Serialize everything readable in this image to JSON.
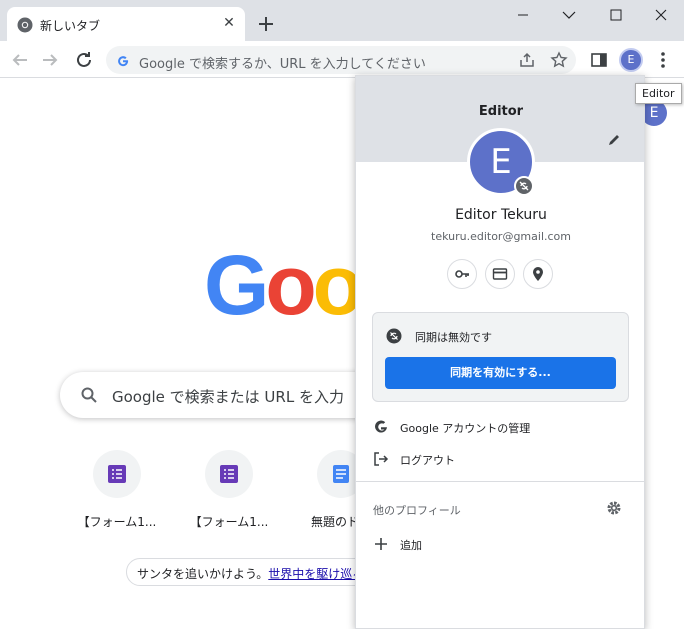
{
  "tab": {
    "title": "新しいタブ"
  },
  "omnibox": {
    "placeholder": "Google で検索するか、URL を入力してください"
  },
  "tooltip": {
    "text": "Editor"
  },
  "toolbar_profile": {
    "initial": "E"
  },
  "ntp": {
    "logo_letters": [
      "G",
      "o",
      "o"
    ],
    "logo_colors": [
      "#4285f4",
      "#ea4335",
      "#fbbc05"
    ],
    "search_placeholder": "Google で検索または URL を入力",
    "shortcuts": [
      {
        "label": "【フォーム1...",
        "icon": "forms-icon"
      },
      {
        "label": "【フォーム1...",
        "icon": "forms-icon"
      },
      {
        "label": "無題のドキ",
        "icon": "docs-icon"
      }
    ],
    "doodle": {
      "text": "サンタを追いかけよう。",
      "link": "世界中を駆け巡る"
    }
  },
  "menu": {
    "header_title": "Editor",
    "avatar_initial": "E",
    "user_name": "Editor Tekuru",
    "email": "tekuru.editor@gmail.com",
    "quick_buttons": [
      "key-icon",
      "credit-card-icon",
      "location-pin-icon"
    ],
    "sync": {
      "status": "同期は無効です",
      "button_label": "同期を有効にする..."
    },
    "manage_account": "Google アカウントの管理",
    "logout": "ログアウト",
    "other_profiles_label": "他のプロフィール",
    "add_label": "追加"
  },
  "colors": {
    "accent": "#1a73e8",
    "avatar": "#5d71c9"
  }
}
